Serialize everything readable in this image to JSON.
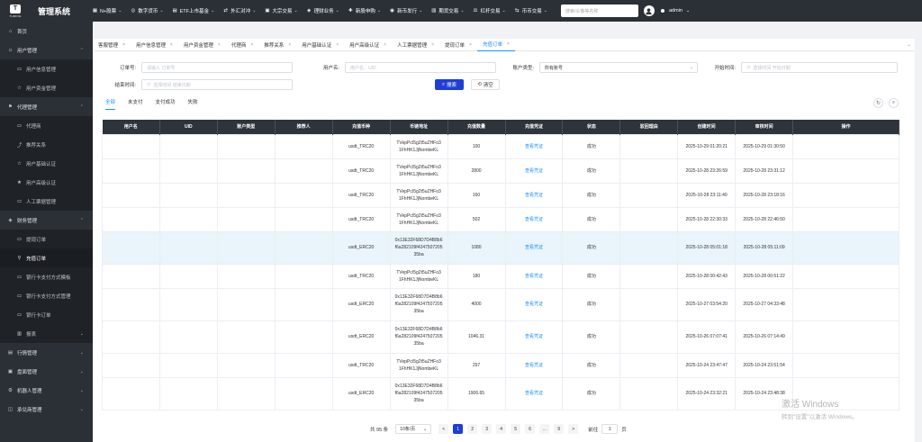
{
  "brand": {
    "logo_text": "TURING",
    "logo_letter": "T",
    "title": "管理系统"
  },
  "topnav": [
    {
      "label": "N+股票",
      "icon": "stock-icon"
    },
    {
      "label": "数字货币",
      "icon": "coin-icon"
    },
    {
      "label": "ETF上市基金",
      "icon": "fund-icon"
    },
    {
      "label": "外汇对冲",
      "icon": "forex-icon"
    },
    {
      "label": "大宗交易",
      "icon": "bulk-trade-icon"
    },
    {
      "label": "理财业务",
      "icon": "finance-icon"
    },
    {
      "label": "新股申购",
      "icon": "ipo-icon"
    },
    {
      "label": "新币发行",
      "icon": "new-coin-icon"
    },
    {
      "label": "期货交易",
      "icon": "futures-icon"
    },
    {
      "label": "杠杆交易",
      "icon": "leverage-icon"
    },
    {
      "label": "币币交易",
      "icon": "exchange-icon"
    }
  ],
  "search": {
    "placeholder": "搜索/头像等名称"
  },
  "user": {
    "name": "admin"
  },
  "sidebar": [
    {
      "label": "首页",
      "type": "group",
      "icon": "home-icon"
    },
    {
      "label": "用户管理",
      "type": "group",
      "icon": "user-icon",
      "arrow": "⌃"
    },
    {
      "label": "用户信息管理",
      "type": "sub",
      "icon": "doc-icon"
    },
    {
      "label": "用户资金管理",
      "type": "sub",
      "icon": "star-icon"
    },
    {
      "label": "代理管理",
      "type": "group",
      "icon": "agent-icon",
      "arrow": "⌃"
    },
    {
      "label": "代理商",
      "type": "sub",
      "icon": "doc-icon"
    },
    {
      "label": "推荐关系",
      "type": "sub",
      "icon": "share-icon"
    },
    {
      "label": "用户基础认证",
      "type": "sub",
      "icon": "star-icon"
    },
    {
      "label": "用户高级认证",
      "type": "sub",
      "icon": "star-fill-icon"
    },
    {
      "label": "人工票据管理",
      "type": "sub",
      "icon": "doc-icon"
    },
    {
      "label": "财务管理",
      "type": "group",
      "icon": "finance-icon",
      "arrow": "⌃"
    },
    {
      "label": "提现订单",
      "type": "sub",
      "icon": "doc-icon"
    },
    {
      "label": "充值订单",
      "type": "sub",
      "icon": "location-icon",
      "active": true
    },
    {
      "label": "银行卡支付方式模板",
      "type": "sub",
      "icon": "doc-icon"
    },
    {
      "label": "银行卡支付方式管理",
      "type": "sub",
      "icon": "doc-icon"
    },
    {
      "label": "银行卡订单",
      "type": "sub",
      "icon": "doc-icon"
    },
    {
      "label": "报表",
      "type": "sub",
      "icon": "report-icon",
      "arrow": "⌄"
    },
    {
      "label": "行情管理",
      "type": "group",
      "icon": "market-icon",
      "arrow": "⌄"
    },
    {
      "label": "盘面管理",
      "type": "group",
      "icon": "board-icon",
      "arrow": "⌄"
    },
    {
      "label": "机器人管理",
      "type": "group",
      "icon": "robot-icon",
      "arrow": "⌄"
    },
    {
      "label": "承兑商管理",
      "type": "group",
      "icon": "merchant-icon",
      "arrow": "⌄"
    }
  ],
  "tabs": [
    {
      "label": "客服管理"
    },
    {
      "label": "用户信息管理"
    },
    {
      "label": "用户资金管理"
    },
    {
      "label": "代理商"
    },
    {
      "label": "推荐关系"
    },
    {
      "label": "用户基础认证"
    },
    {
      "label": "用户高级认证"
    },
    {
      "label": "人工票据管理"
    },
    {
      "label": "提现订单"
    },
    {
      "label": "充值订单",
      "active": true
    }
  ],
  "filters": {
    "order_no": {
      "label": "订单号:",
      "placeholder": "请输入 订单号"
    },
    "username": {
      "label": "用户名:",
      "placeholder": "用户名、UID"
    },
    "account_type": {
      "label": "账户类型:",
      "value": "所有账号"
    },
    "start_time": {
      "label": "开始时间:",
      "placeholder": "选择时间 开始日期"
    },
    "end_time": {
      "label": "结束时间:",
      "placeholder": "选择时间 结束日期"
    },
    "search_btn": "搜索",
    "clear_btn": "清空"
  },
  "subtabs": [
    {
      "label": "全部",
      "active": true
    },
    {
      "label": "未支付"
    },
    {
      "label": "支付成功"
    },
    {
      "label": "失败"
    }
  ],
  "table": {
    "columns": [
      "用户名",
      "UID",
      "账户类型",
      "推荐人",
      "充值币种",
      "币链地址",
      "充值数量",
      "充值凭证",
      "状态",
      "驳回理由",
      "创建时间",
      "审核时间",
      "操作"
    ],
    "rows": [
      {
        "coin": "usdt_TRC20",
        "addr": [
          "TVepPcI5g2t5uZHFo3",
          "1FhHK1JjNombeKL"
        ],
        "amount": "100",
        "proof": "查看凭证",
        "status": "成功",
        "created": "2025-10-29 01:20:21",
        "reviewed": "2025-10-29 01:30:50"
      },
      {
        "coin": "usdt_TRC20",
        "addr": [
          "TVepPcI5g2t5uZHFo3",
          "1FhHK1JjNombeKL"
        ],
        "amount": "2800",
        "proof": "查看凭证",
        "status": "成功",
        "created": "2025-10-28 23:26:59",
        "reviewed": "2025-10-28 23:31:12"
      },
      {
        "coin": "usdt_TRC20",
        "addr": [
          "TVepPcI5g2t5uZHFo3",
          "1FhHK1JjNombeKL"
        ],
        "amount": "160",
        "proof": "查看凭证",
        "status": "成功",
        "created": "2025-10-28 23:11:40",
        "reviewed": "2025-10-28 23:18:16"
      },
      {
        "coin": "usdt_TRC20",
        "addr": [
          "TVepPcI5g2t5uZHFo3",
          "1FhHK1JjNombeKL"
        ],
        "amount": "502",
        "proof": "查看凭证",
        "status": "成功",
        "created": "2025-10-28 22:30:33",
        "reviewed": "2025-10-28 22:46:50"
      },
      {
        "coin": "usdt_ERC20",
        "addr": [
          "0x13E32F68D7D4B8b6",
          "f6a282109f4247507205",
          "35ba"
        ],
        "amount": "1080",
        "proof": "查看凭证",
        "status": "成功",
        "created": "2025-10-28 05:01:18",
        "reviewed": "2025-10-28 05:11:09",
        "highlight": true
      },
      {
        "coin": "usdt_TRC20",
        "addr": [
          "TVepPcI5g2t5uZHFo3",
          "1FhHK1JjNombeKL"
        ],
        "amount": "180",
        "proof": "查看凭证",
        "status": "成功",
        "created": "2025-10-28 00:42:43",
        "reviewed": "2025-10-28 00:51:22"
      },
      {
        "coin": "usdt_ERC20",
        "addr": [
          "0x13E32F68D7D4B8b6",
          "f6a282109f4247507205",
          "35ba"
        ],
        "amount": "4000",
        "proof": "查看凭证",
        "status": "成功",
        "created": "2025-10-27 03:54:20",
        "reviewed": "2025-10-27 04:33:48"
      },
      {
        "coin": "usdt_ERC20",
        "addr": [
          "0x13E32F68D7D4B8b6",
          "f6a282109f4247507205",
          "35ba"
        ],
        "amount": "1046.31",
        "proof": "查看凭证",
        "status": "成功",
        "created": "2025-10-26 07:07:41",
        "reviewed": "2025-10-26 07:14:49"
      },
      {
        "coin": "usdt_TRC20",
        "addr": [
          "TVepPcI5g2t5uZHFo3",
          "1FhHK1JjNombeKL"
        ],
        "amount": "297",
        "proof": "查看凭证",
        "status": "成功",
        "created": "2025-10-24 23:47:47",
        "reviewed": "2025-10-24 23:51:54"
      },
      {
        "coin": "usdt_ERC20",
        "addr": [
          "0x13E32F68D7D4B8b6",
          "f6a282109f4247507205",
          "35ba"
        ],
        "amount": "1906.65",
        "proof": "查看凭证",
        "status": "成功",
        "created": "2025-10-24 23:32:21",
        "reviewed": "2025-10-24 23:48:38"
      }
    ]
  },
  "pager": {
    "total": "共 95 条",
    "page_size": "10条/页",
    "pages": [
      "1",
      "2",
      "3",
      "4",
      "5",
      "6",
      "…",
      "9"
    ],
    "current": "1",
    "prev": "<",
    "next": ">",
    "goto_label": "前往",
    "goto_value": "1",
    "goto_unit": "页"
  },
  "watermark": {
    "line1": "激活 Windows",
    "line2": "转到\"设置\"以激活 Windows。"
  }
}
